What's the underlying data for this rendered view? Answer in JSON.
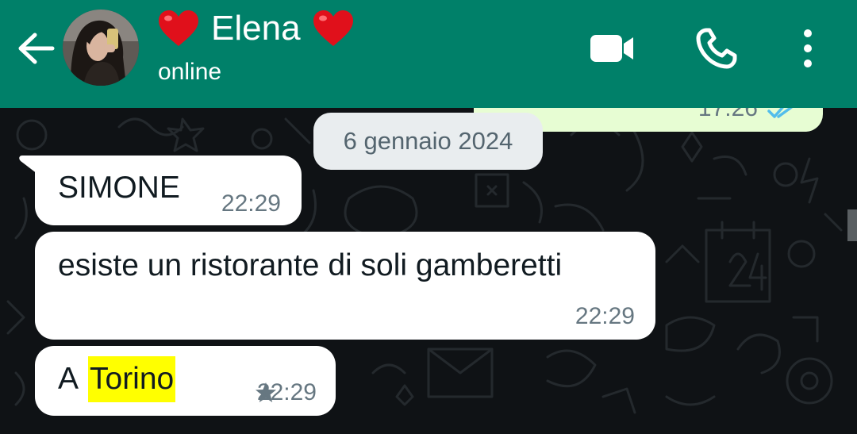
{
  "header": {
    "contact_name": "Elena",
    "status": "online"
  },
  "icons": {
    "back": "arrow-left-icon",
    "video": "video-camera-icon",
    "call": "phone-icon",
    "menu": "more-vertical-icon",
    "heart": "heart-emoji-icon",
    "star": "star-icon",
    "read": "double-check-icon"
  },
  "previous_message": {
    "time": "17:26"
  },
  "date_chip": "6 gennaio 2024",
  "messages": [
    {
      "text": "SIMONE",
      "time": "22:29",
      "starred": false
    },
    {
      "text": "esiste un ristorante di soli gamberetti",
      "time": "22:29",
      "starred": false
    },
    {
      "text_prefix": "A ",
      "text_highlight": "Torino",
      "time": "22:29",
      "starred": true
    }
  ],
  "colors": {
    "header": "#008069",
    "chat_background": "#0f1215",
    "incoming_bubble": "#ffffff",
    "outgoing_bubble": "#e7fdd3",
    "date_chip": "#e9edef",
    "search_highlight": "#ffff00",
    "read_ticks": "#53bdeb"
  }
}
